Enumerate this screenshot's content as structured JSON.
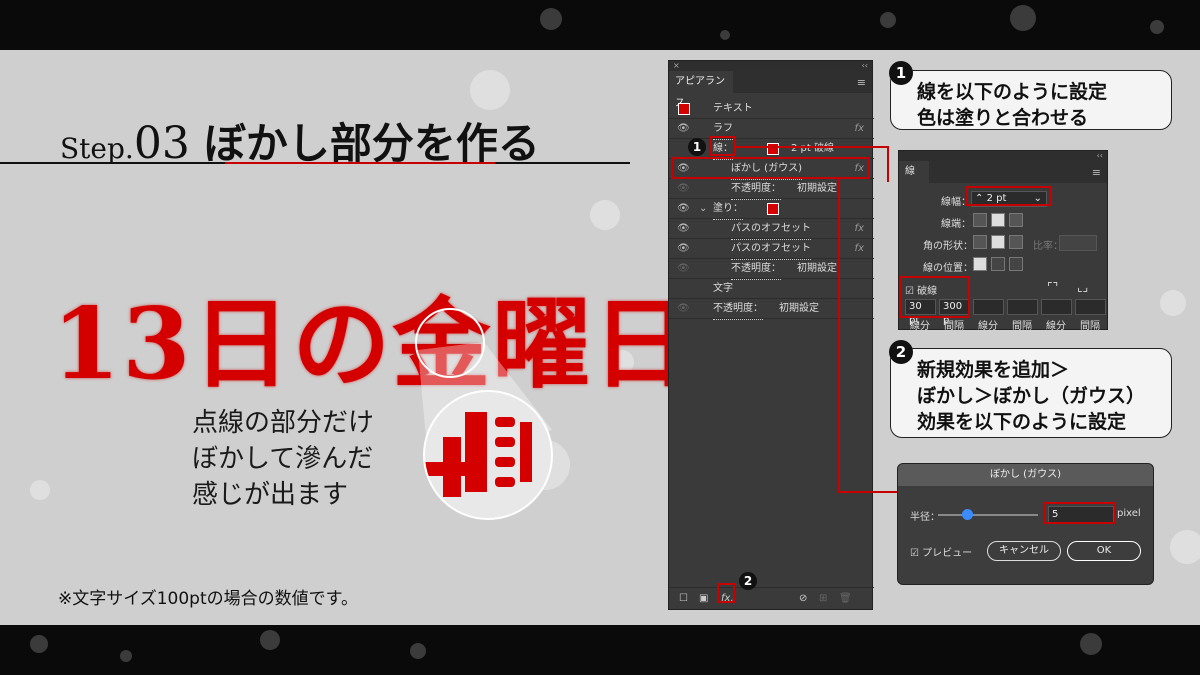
{
  "step": {
    "prefix": "Step.",
    "number": "03",
    "title": "ぼかし部分を作る"
  },
  "sample_text": "13日の金曜日",
  "caption": [
    "点線の部分だけ",
    "ぼかして滲んだ",
    "感じが出ます"
  ],
  "footnote": "※文字サイズ100ptの場合の数値です。",
  "appearance_panel": {
    "close": "×",
    "collapse": "‹‹",
    "tab": "アピアランス",
    "menu": "≡",
    "rows": {
      "text_label": "テキスト",
      "rough_label": "ラフ",
      "stroke_label": "線：",
      "stroke_value": "2 pt 破線",
      "blur_label": "ぼかし (ガウス)",
      "opacity1_label": "不透明度：",
      "opacity1_value": "初期設定",
      "fill_label": "塗り：",
      "offset1_label": "パスのオフセット",
      "offset2_label": "パスのオフセット",
      "opacity2_label": "不透明度：",
      "opacity2_value": "初期設定",
      "chars_label": "文字",
      "opacity3_label": "不透明度：",
      "opacity3_value": "初期設定"
    },
    "fx": "fx"
  },
  "badges": {
    "one": "1",
    "two": "2"
  },
  "callout1": [
    "線を以下のように設定",
    "色は塗りと合わせる"
  ],
  "callout2": [
    "新規効果を追加＞",
    "ぼかし＞ぼかし（ガウス）",
    "効果を以下のように設定"
  ],
  "stroke_panel": {
    "tab": "線",
    "weight_label": "線幅：",
    "weight_value": "2 pt",
    "cap_label": "線端：",
    "corner_label": "角の形状：",
    "limit_label": "比率：",
    "align_label": "線の位置：",
    "dashed_label": "破線",
    "dash_value": "30 pt",
    "gap_value": "300 p",
    "dash_labels": [
      "線分",
      "間隔",
      "線分",
      "間隔",
      "線分",
      "間隔"
    ]
  },
  "blur_dialog": {
    "title": "ぼかし (ガウス)",
    "radius_label": "半径：",
    "radius_value": "5",
    "unit": "pixel",
    "radius_slider_position": 0.25,
    "preview_label": "プレビュー",
    "cancel": "キャンセル",
    "ok": "OK"
  },
  "colors": {
    "accent_red": "#d40000",
    "panel_bg": "#3a3a3a",
    "canvas_bg": "#cfcfcf"
  }
}
